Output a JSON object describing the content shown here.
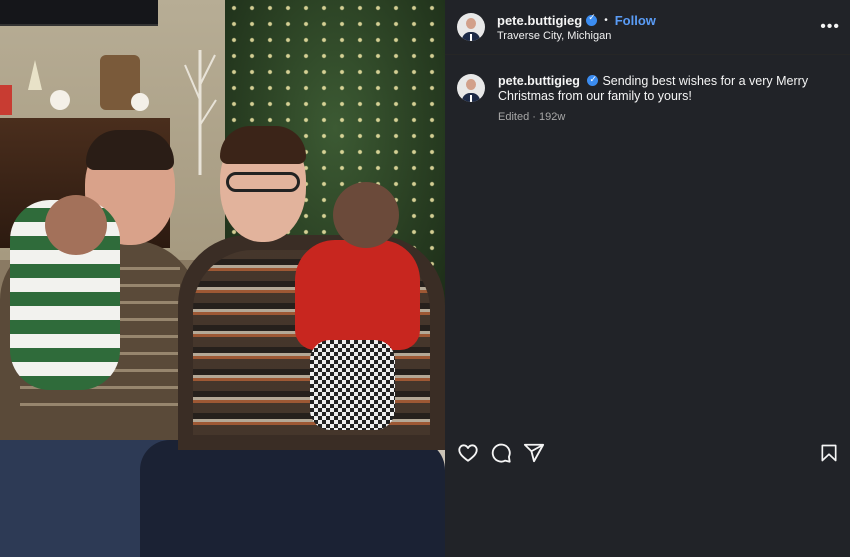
{
  "post": {
    "image_alt": "Family Christmas photo in front of a decorated tree"
  },
  "header": {
    "username": "pete.buttigieg",
    "verified_icon": "verified-badge-icon",
    "separator": "•",
    "follow_label": "Follow",
    "location": "Traverse City, Michigan",
    "more_label": "•••"
  },
  "caption": {
    "username": "pete.buttigieg",
    "text": "Sending best wishes for a very Merry Christmas from our family to yours!",
    "edited": "Edited",
    "sep": " · ",
    "age": "192w"
  },
  "actions": {
    "like_icon": "heart-icon",
    "comment_icon": "comment-icon",
    "share_icon": "share-icon",
    "save_icon": "bookmark-icon"
  },
  "colors": {
    "panel_bg": "#212328",
    "accent": "#5a9cf6",
    "verified": "#3b8cf0"
  }
}
